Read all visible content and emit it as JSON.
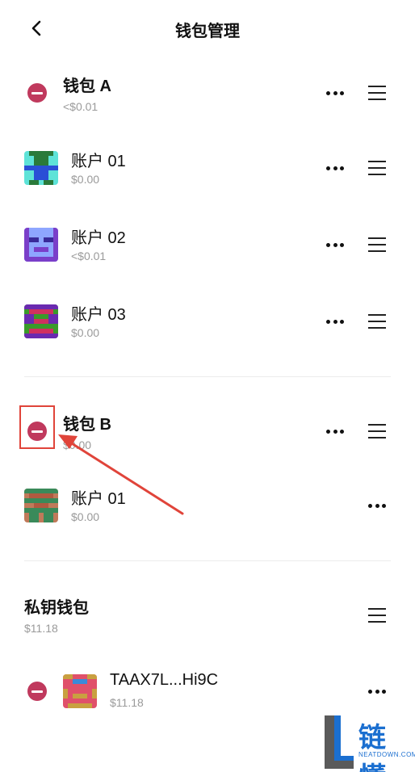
{
  "header": {
    "title": "钱包管理",
    "back_icon": "chevron-left-icon"
  },
  "wallet_a": {
    "name": "钱包 A",
    "balance": "<$0.01",
    "accounts": [
      {
        "name": "账户 01",
        "balance": "$0.00",
        "avatar_colors": [
          "#2a7a3a",
          "#5ee3d8",
          "#2a4fd6"
        ]
      },
      {
        "name": "账户 02",
        "balance": "<$0.01",
        "avatar_colors": [
          "#7a3fc9",
          "#8ea6ff",
          "#3a2a9a"
        ]
      },
      {
        "name": "账户 03",
        "balance": "$0.00",
        "avatar_colors": [
          "#6a2ab0",
          "#3a9a2a",
          "#d03060"
        ]
      }
    ]
  },
  "wallet_b": {
    "name": "钱包 B",
    "balance": "$0.00",
    "accounts": [
      {
        "name": "账户 01",
        "balance": "$0.00",
        "avatar_colors": [
          "#3a8a5a",
          "#b05a40",
          "#c07a5a"
        ]
      }
    ]
  },
  "private_key_wallet": {
    "name": "私钥钱包",
    "balance": "$11.18",
    "accounts": [
      {
        "name": "TAAX7L...Hi9C",
        "balance": "$11.18",
        "avatar_colors": [
          "#e0506a",
          "#c9a040",
          "#3a8ad8"
        ]
      }
    ]
  },
  "watermark": {
    "brand": "链懂",
    "domain": "NEATDOWN.COM"
  },
  "colors": {
    "remove": "#c0395d",
    "annotation": "#e0443a",
    "muted_text": "#9a9a9a"
  }
}
